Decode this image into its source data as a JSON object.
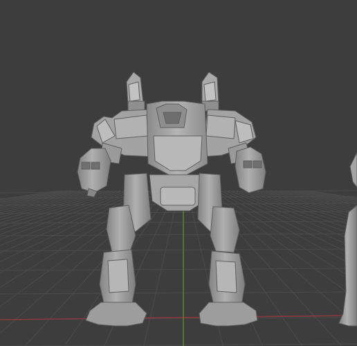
{
  "viewport": {
    "background": "#3d3d3d",
    "grid_color": "#4a4a4a",
    "x_axis_color": "#8a3a3f",
    "y_axis_color": "#5a8a2a",
    "model_color": "#a4a4a4",
    "model_shade": "#7c7c7c",
    "model_highlight": "#c2c2c2"
  },
  "objects": [
    {
      "name": "mech-model"
    },
    {
      "name": "secondary-model-partial"
    }
  ]
}
